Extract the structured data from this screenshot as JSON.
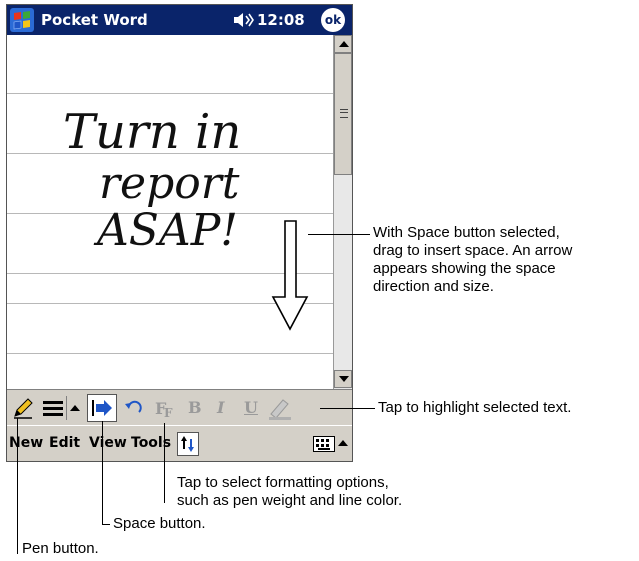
{
  "window": {
    "app_title": "Pocket Word",
    "clock": "12:08",
    "ok_label": "ok"
  },
  "document": {
    "handwriting": [
      "Turn in",
      "report",
      "ASAP!"
    ]
  },
  "pen_toolbar": {
    "tools": [
      "pen-icon",
      "pen-weight-icon",
      "toolbar-up-arrow-icon",
      "space-icon",
      "undo-icon",
      "font-icon",
      "bold-icon",
      "italic-icon",
      "underline-icon",
      "highlight-icon"
    ],
    "bold": "B",
    "italic": "I",
    "underline": "U"
  },
  "menu": {
    "items": [
      "New",
      "Edit",
      "View",
      "Tools"
    ]
  },
  "callouts": {
    "space_arrow": [
      "With Space button selected,",
      "drag to insert space. An arrow",
      "appears showing the space",
      "direction and size."
    ],
    "highlight": "Tap to highlight selected text.",
    "formatting": [
      "Tap to select formatting options,",
      "such as pen weight and line color."
    ],
    "space_button": "Space button.",
    "pen_button": "Pen button."
  },
  "colors": {
    "titlebar": "#0a246a",
    "toolbar": "#d4d0c8",
    "space_selected": "#1f56c7"
  }
}
